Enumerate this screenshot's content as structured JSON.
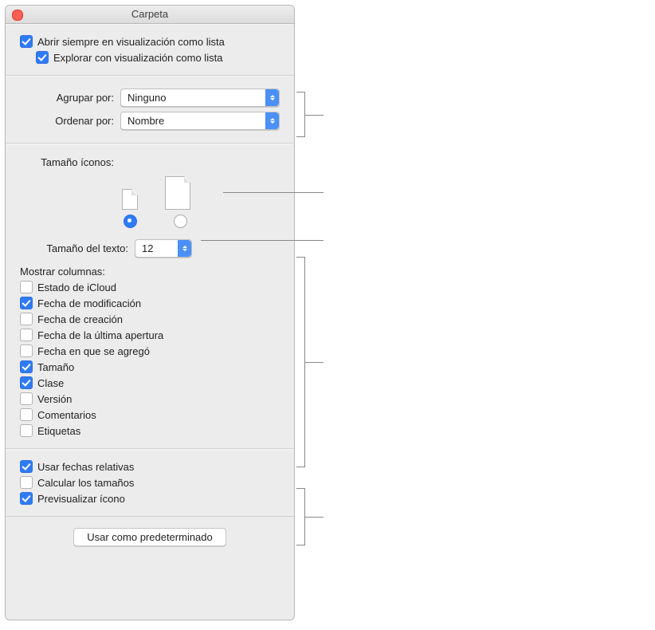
{
  "window": {
    "title": "Carpeta"
  },
  "top_options": {
    "always_list": {
      "label": "Abrir siempre en visualización como lista",
      "checked": true
    },
    "browse_list": {
      "label": "Explorar con visualización como lista",
      "checked": true
    }
  },
  "grouping": {
    "group_by_label": "Agrupar por:",
    "group_by_value": "Ninguno",
    "sort_by_label": "Ordenar por:",
    "sort_by_value": "Nombre"
  },
  "icon_size": {
    "label": "Tamaño íconos:",
    "selected": "small"
  },
  "text_size": {
    "label": "Tamaño del texto:",
    "value": "12"
  },
  "columns": {
    "heading": "Mostrar columnas:",
    "items": [
      {
        "label": "Estado de iCloud",
        "checked": false
      },
      {
        "label": "Fecha de modificación",
        "checked": true
      },
      {
        "label": "Fecha de creación",
        "checked": false
      },
      {
        "label": "Fecha de la última apertura",
        "checked": false
      },
      {
        "label": "Fecha en que se agregó",
        "checked": false
      },
      {
        "label": "Tamaño",
        "checked": true
      },
      {
        "label": "Clase",
        "checked": true
      },
      {
        "label": "Versión",
        "checked": false
      },
      {
        "label": "Comentarios",
        "checked": false
      },
      {
        "label": "Etiquetas",
        "checked": false
      }
    ]
  },
  "bottom_options": {
    "relative_dates": {
      "label": "Usar fechas relativas",
      "checked": true
    },
    "calc_sizes": {
      "label": "Calcular los tamaños",
      "checked": false
    },
    "icon_preview": {
      "label": "Previsualizar ícono",
      "checked": true
    }
  },
  "footer": {
    "use_default": "Usar como predeterminado"
  }
}
